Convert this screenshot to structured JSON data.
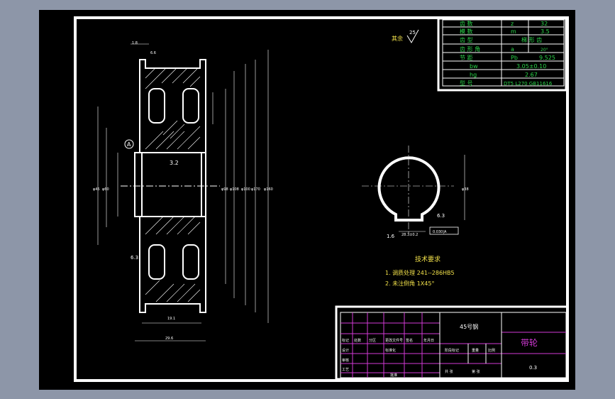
{
  "colors": {
    "background": "#8d96a8",
    "canvas": "#000000",
    "line": "#ffffff",
    "text_green": "#2bd44a",
    "text_yellow": "#f2e14a",
    "grid_magenta": "#d23ad6"
  },
  "param_table": {
    "rows": [
      {
        "name": "齿    数",
        "sym": "z",
        "val": "32"
      },
      {
        "name": "模    数",
        "sym": "m",
        "val": "3.5"
      },
      {
        "name": "齿    型",
        "sym": "",
        "val": "梯 形 齿"
      },
      {
        "name": "齿 形 角",
        "sym": "a",
        "val": "20°"
      },
      {
        "name": "节    距",
        "sym": "Pb",
        "val": "9.525"
      },
      {
        "name": "bw",
        "sym": "",
        "val": "3.05±0.10"
      },
      {
        "name": "hg",
        "sym": "",
        "val": "2.67"
      },
      {
        "name": "型    号",
        "sym": "",
        "val": "DT5 L270 GB11616"
      }
    ]
  },
  "rest_roughness": {
    "label": "其余",
    "value": "25"
  },
  "datum": "A",
  "section_notes": {
    "roughness": "3.2",
    "dim_top": "1.8",
    "dim_top2": "6.6",
    "chamfer": "6.3",
    "width": "19.1",
    "total_width": "29.6",
    "diam_labels": [
      "φ45",
      "φ60",
      "φ98",
      "φ108",
      "φ100",
      "φ170",
      "φ160"
    ]
  },
  "keyway_view": {
    "dim_vertical": "φ38",
    "dim_bottom_left": "28.3±0.2",
    "dim_bottom_right": "0.030|A",
    "roughness1": "6.3",
    "roughness2": "1.6"
  },
  "tech_req": {
    "title": "技术要求",
    "items": [
      "1. 调质处理 241--286HB5",
      "2. 未注倒角 1X45°"
    ]
  },
  "title_block": {
    "material": "45号钢",
    "part_name": "带轮",
    "scale": "0.3",
    "cells": [
      "标记",
      "处数",
      "分区",
      "更改文件号",
      "签名",
      "年月日",
      "设计",
      "标准化",
      "阶段标记",
      "重量",
      "比例",
      "审核",
      "工艺",
      "批准",
      "共 张",
      "第 张"
    ]
  }
}
